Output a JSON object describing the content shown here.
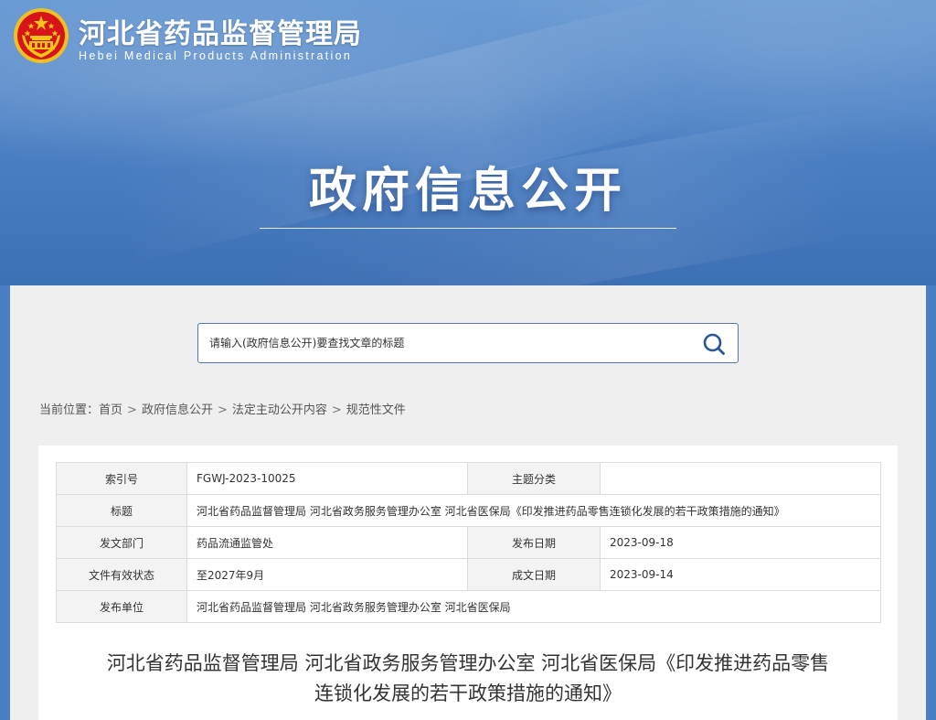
{
  "header": {
    "site_name": "河北省药品监督管理局",
    "site_name_en": "Hebei Medical Products Administration",
    "banner_title": "政府信息公开"
  },
  "search": {
    "placeholder": "请输入(政府信息公开)要查找文章的标题",
    "icon": "search-icon"
  },
  "breadcrumb": {
    "prefix": "当前位置：",
    "items": [
      "首页",
      "政府信息公开",
      "法定主动公开内容",
      "规范性文件"
    ],
    "separator": ">"
  },
  "meta_table": {
    "index_label": "索引号",
    "index_value": "FGWJ-2023-10025",
    "topic_label": "主题分类",
    "topic_value": "",
    "title_label": "标题",
    "title_value": "河北省药品监督管理局 河北省政务服务管理办公室 河北省医保局《印发推进药品零售连锁化发展的若干政策措施的通知》",
    "dept_label": "发文部门",
    "dept_value": "药品流通监管处",
    "publish_date_label": "发布日期",
    "publish_date_value": "2023-09-18",
    "validity_label": "文件有效状态",
    "validity_value": "至2027年9月",
    "created_date_label": "成文日期",
    "created_date_value": "2023-09-14",
    "publisher_label": "发布单位",
    "publisher_value": "河北省药品监督管理局 河北省政务服务管理办公室 河北省医保局"
  },
  "article": {
    "title_line1": "河北省药品监督管理局 河北省政务服务管理办公室 河北省医保局《印发推进药品零售",
    "title_line2": "连锁化发展的若干政策措施的通知》"
  },
  "colors": {
    "hero_blue": "#4a7ec2",
    "emblem_red": "#d7141a",
    "emblem_gold": "#f5c518",
    "search_border": "#5577b0"
  }
}
